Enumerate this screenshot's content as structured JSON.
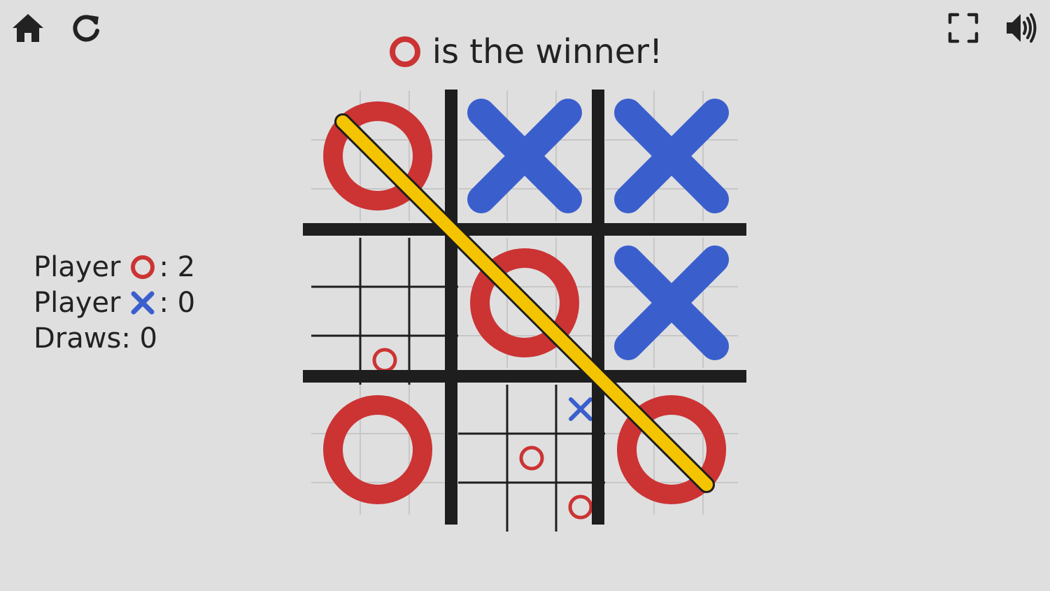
{
  "toolbar": {
    "home_icon": "home-icon",
    "restart_icon": "restart-icon",
    "fullscreen_icon": "fullscreen-icon",
    "sound_icon": "sound-icon"
  },
  "status": {
    "winner_symbol": "O",
    "message": "is the winner!"
  },
  "scores": {
    "player_o_label": "Player",
    "player_o_value": ": 2",
    "player_x_label": "Player",
    "player_x_value": ": 0",
    "draws_label": "Draws: 0"
  },
  "board": {
    "cells": [
      [
        "O",
        "X",
        "X"
      ],
      [
        "",
        "O",
        "X"
      ],
      [
        "O",
        "",
        "O"
      ]
    ],
    "mini_boards": {
      "1,0": [
        "",
        "",
        "",
        "",
        "",
        "",
        "",
        "O",
        ""
      ],
      "2,1": [
        "",
        "",
        "X",
        "",
        "O",
        "",
        "",
        "",
        "O"
      ]
    },
    "winning_line": "diagonal top-left to bottom-right"
  },
  "colors": {
    "background": "#dfdfdf",
    "o_red": "#cc3333",
    "x_blue": "#3a5fcd",
    "grid": "#1e1e1e",
    "win_line": "#f5c400"
  }
}
